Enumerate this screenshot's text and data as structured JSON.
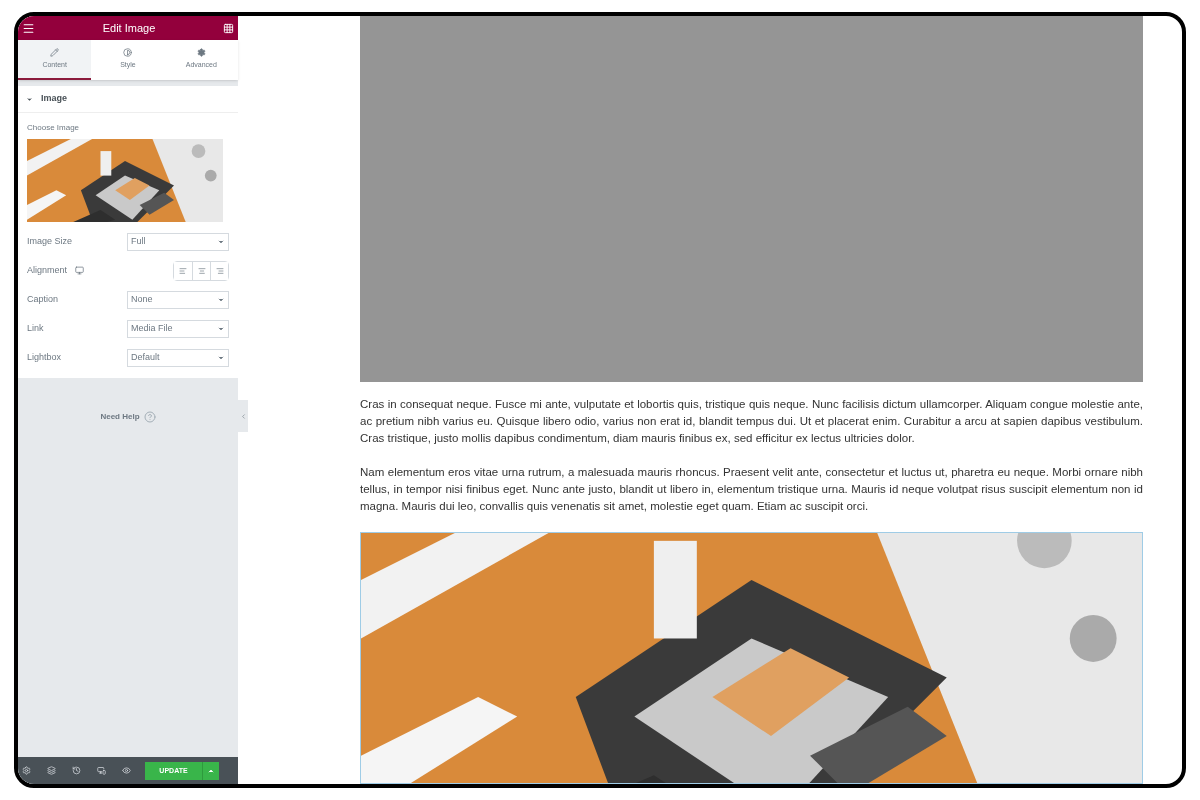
{
  "panel": {
    "title": "Edit Image",
    "tabs": [
      {
        "label": "Content",
        "selected": true
      },
      {
        "label": "Style",
        "selected": false
      },
      {
        "label": "Advanced",
        "selected": false
      }
    ],
    "section": {
      "title": "Image",
      "expanded": true
    },
    "choose_image_label": "Choose Image",
    "controls": [
      {
        "kind": "select",
        "label": "Image Size",
        "value": "Full"
      },
      {
        "kind": "alignment",
        "label": "Alignment"
      },
      {
        "kind": "select",
        "label": "Caption",
        "value": "None"
      },
      {
        "kind": "select",
        "label": "Link",
        "value": "Media File"
      },
      {
        "kind": "select",
        "label": "Lightbox",
        "value": "Default"
      }
    ],
    "help": "Need Help",
    "update_button": "UPDATE"
  },
  "page": {
    "paragraphs": [
      "Cras in consequat neque. Fusce mi ante, vulputate et lobortis quis, tristique quis neque. Nunc facilisis dictum ullamcorper. Aliquam congue molestie ante, ac pretium nibh varius eu. Quisque libero odio, varius non erat id, blandit tempus dui. Ut et placerat enim. Curabitur a arcu at sapien dapibus vestibulum. Cras tristique, justo mollis dapibus condimentum, diam mauris finibus ex, sed efficitur ex lectus ultricies dolor.",
      "Nam elementum eros vitae urna rutrum, a malesuada mauris rhoncus. Praesent velit ante, consectetur et luctus ut, pharetra eu neque. Morbi ornare nibh tellus, in tempor nisi finibus eget. Nunc ante justo, blandit ut libero in, elementum tristique urna. Mauris id neque volutpat risus suscipit elementum non id magna. Mauris dui leo, convallis quis venenatis sit amet, molestie eget quam. Etiam ac suscipit orci."
    ]
  }
}
